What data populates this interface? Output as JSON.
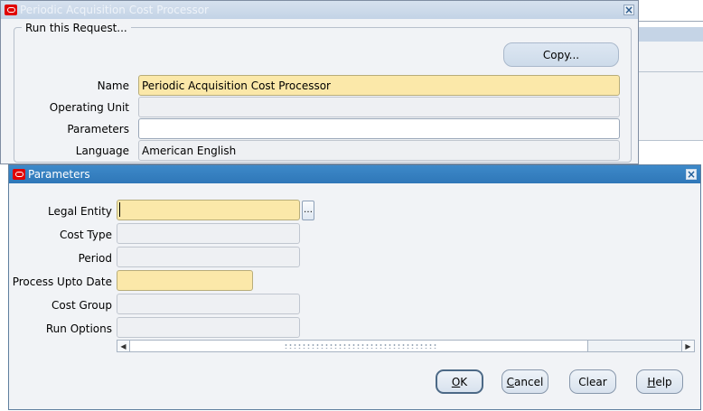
{
  "request_window": {
    "title": "Periodic Acquisition Cost Processor",
    "group_title": "Run this Request...",
    "copy_button": {
      "label": "Copy...",
      "underline_index": 3
    },
    "fields": [
      {
        "label": "Name",
        "value": "Periodic Acquisition Cost Processor",
        "state": "required"
      },
      {
        "label": "Operating Unit",
        "value": "",
        "state": "readonly"
      },
      {
        "label": "Parameters",
        "value": "",
        "state": "editable"
      },
      {
        "label": "Language",
        "value": "American English",
        "state": "readonly"
      }
    ]
  },
  "parameters_window": {
    "title": "Parameters",
    "fields": [
      {
        "label": "Legal Entity",
        "value": "",
        "state": "required",
        "has_lov": true,
        "focused": true
      },
      {
        "label": "Cost Type",
        "value": "",
        "state": "readonly"
      },
      {
        "label": "Period",
        "value": "",
        "state": "readonly"
      },
      {
        "label": "Process Upto Date",
        "value": "",
        "state": "required"
      },
      {
        "label": "Cost Group",
        "value": "",
        "state": "readonly"
      },
      {
        "label": "Run Options",
        "value": "",
        "state": "readonly"
      }
    ],
    "lov_button_label": "…",
    "buttons": [
      {
        "label": "OK",
        "mnemonic": "O",
        "rest": "K",
        "default": true
      },
      {
        "label": "Cancel",
        "mnemonic": "C",
        "rest": "ancel",
        "default": false
      },
      {
        "label": "Clear",
        "mnemonic": "",
        "rest": "Clear",
        "default": false
      },
      {
        "label": "Help",
        "mnemonic": "H",
        "rest": "elp",
        "default": false
      }
    ]
  },
  "icons": {
    "app_logo": "oracle-logo-icon",
    "close": "close-icon",
    "scroll_left": "chevron-left-icon",
    "scroll_right": "chevron-right-icon"
  },
  "colors": {
    "required_field": "#fbe8a9",
    "active_title": "#2f77b8",
    "inactive_title": "#c3d3e6",
    "logo": "#e00000"
  }
}
